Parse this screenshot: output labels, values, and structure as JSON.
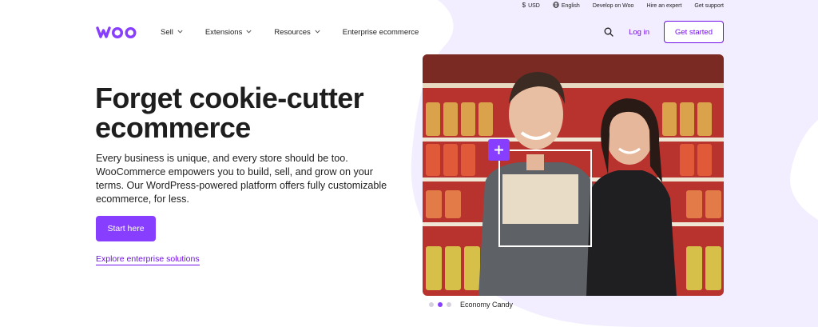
{
  "utility": {
    "currency_glyph": "$",
    "currency": "USD",
    "language_glyph": "◎",
    "language": "English",
    "develop": "Develop on Woo",
    "hire": "Hire an expert",
    "support": "Get support"
  },
  "nav": {
    "logo_text": "woo",
    "sell": "Sell",
    "extensions": "Extensions",
    "resources": "Resources",
    "enterprise": "Enterprise ecommerce",
    "login": "Log in",
    "get_started": "Get started",
    "chevron": "⌄"
  },
  "hero": {
    "title": "Forget cookie-cutter ecommerce",
    "copy": "Every business is unique, and every store should be too. WooCommerce empowers you to build, sell, and grow on your terms. Our WordPress-powered platform offers fully customizable ecommerce, for less.",
    "start_button": "Start here",
    "explore_link": "Explore enterprise solutions"
  },
  "carousel": {
    "caption": "Economy Candy",
    "active_index": 1,
    "dot_count": 3
  },
  "colors": {
    "brand": "#873eff",
    "link": "#720eec",
    "blob": "#f2edff"
  }
}
